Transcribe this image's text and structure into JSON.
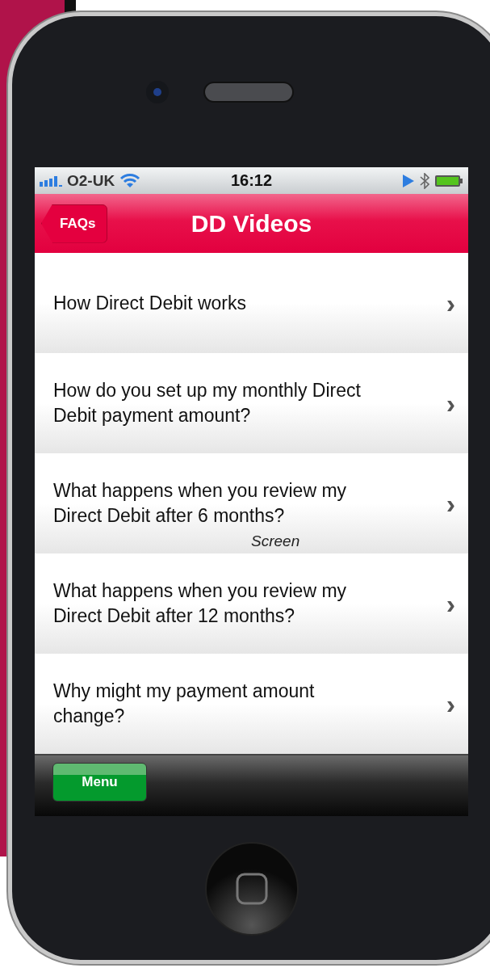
{
  "status_bar": {
    "carrier": "O2-UK",
    "time": "16:12"
  },
  "nav_bar": {
    "back_button": "FAQs",
    "title": "DD Videos"
  },
  "list": [
    {
      "label": "How Direct Debit works",
      "chevron": "›"
    },
    {
      "label": "How do you set up my monthly Direct Debit payment amount?",
      "chevron": "›"
    },
    {
      "label": "What happens when you review my Direct Debit after 6 months?",
      "chevron": "›"
    },
    {
      "label": "What happens when you review my Direct Debit after 12 months?",
      "chevron": "›"
    },
    {
      "label": "Why might my payment amount change?",
      "chevron": "›"
    }
  ],
  "overlay_label": "Screen",
  "toolbar": {
    "menu_button": "Menu"
  }
}
